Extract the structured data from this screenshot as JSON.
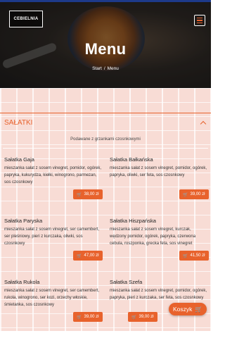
{
  "header": {
    "logo_text": "CEBIELNIA",
    "menu_icon": "hamburger-icon",
    "title": "Menu",
    "breadcrumb": {
      "home": "Start",
      "separator": "/",
      "current": "Menu"
    }
  },
  "category": {
    "title": "SAŁATKI",
    "note": "Podawane z grzankami czosnkowymi",
    "toggle_icon": "chevron-up-icon"
  },
  "items": [
    {
      "name": "Sałatka Gaja",
      "description": "mieszanka sałat z sosem vinegret, pomidor, ogórek, papryka, kukurydza, kiełki, winogrono, parmezan, sos czosnkowy",
      "price": "38,00 zł"
    },
    {
      "name": "Sałatka Bałkańska",
      "description": "mieszanka sałat z sosem vinegret, pomidor, ogórek, papryka, oliwki, ser feta, sos czosnkowy",
      "price": "39,00 zł"
    },
    {
      "name": "Sałatka Paryska",
      "description": "mieszanka sałat z sosem vinegret, ser camembert, ser pleśniowy, pieri z kurczaka, oliwki, sos czosnkowy",
      "price": "47,00 zł"
    },
    {
      "name": "Sałatka Hiszpańska",
      "description": "mieszanka sałat z sosem vinegret, kurczak, wędzony pomidor, ogórek, papryka, czerwona cebula, roszponka, grecka feta, sos vinegret",
      "price": "41,50 zł"
    },
    {
      "name": "Sałatka Rukola",
      "description": "mieszanka sałat z sosem vinegret, ser camembert, rukola, winogrono, ser kozi, orzechy włoskie, śmietanka, sos czosnkowy",
      "price": "39,00 zł"
    },
    {
      "name": "Sałatka Szefa",
      "description": "mieszanka sałat z sosem vinegret, pomidor, ogórek, papryka, pieri z kurczaka, ser feta, sos czosnkowy",
      "price": "39,00 zł"
    }
  ],
  "cart": {
    "label": "Koszyk",
    "icon": "cart-icon"
  },
  "colors": {
    "accent": "#e8622c",
    "topline": "#1d3a8a"
  }
}
